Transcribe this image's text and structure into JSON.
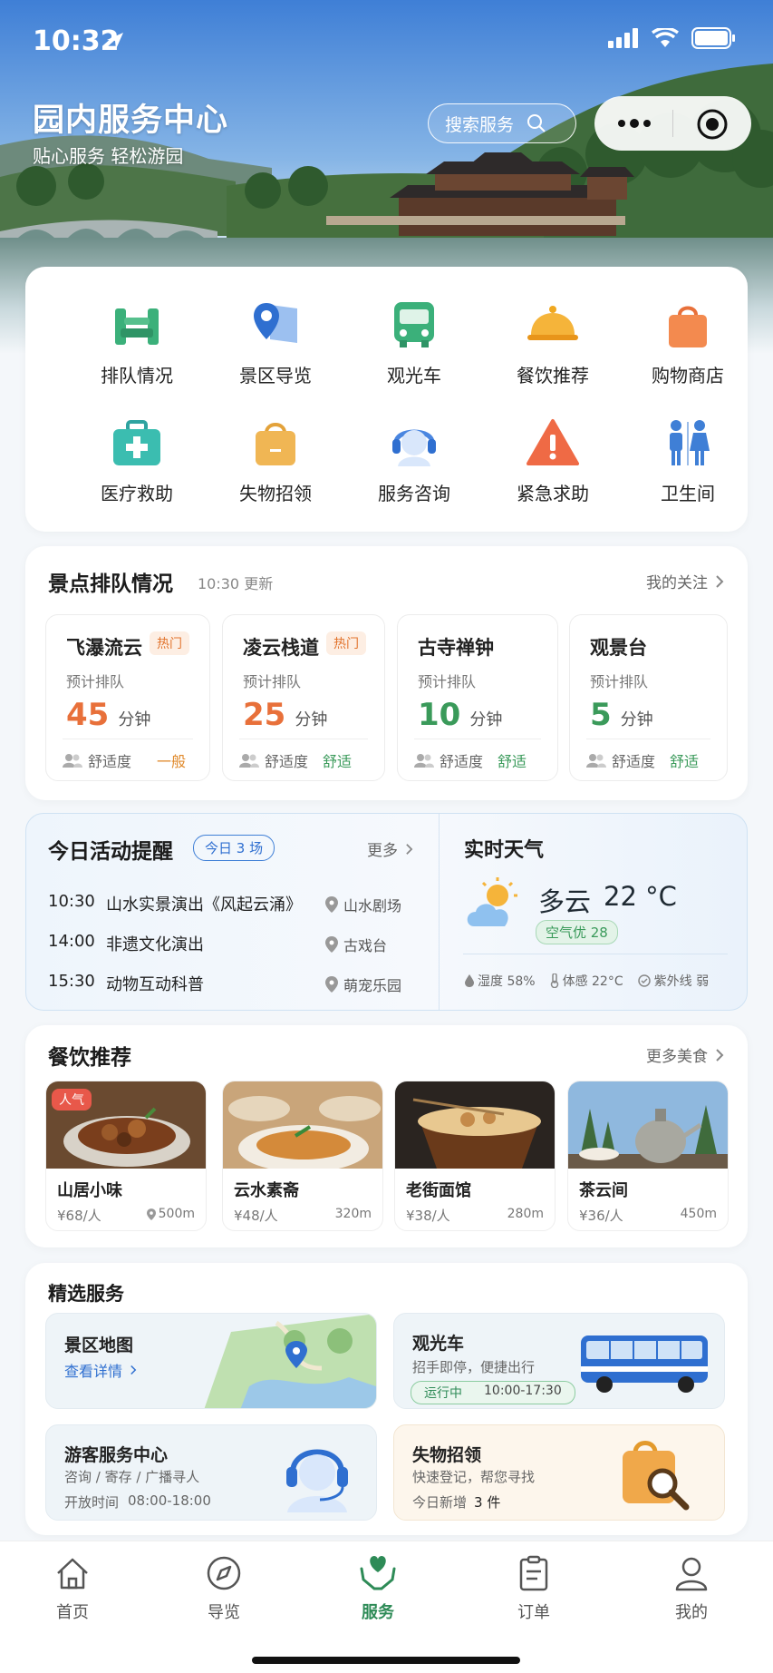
{
  "status_bar": {
    "time": "10:32"
  },
  "hero": {
    "title": "园内服务中心",
    "subtitle": "贴心服务  轻松游园",
    "search_label": "搜索服务"
  },
  "quick_grid": {
    "items": [
      {
        "label": "排队情况",
        "icon": "queue-turnstile-icon"
      },
      {
        "label": "景区导览",
        "icon": "map-pin-icon"
      },
      {
        "label": "观光车",
        "icon": "bus-icon"
      },
      {
        "label": "餐饮推荐",
        "icon": "food-cloche-icon"
      },
      {
        "label": "购物商店",
        "icon": "shopping-bag-icon"
      },
      {
        "label": "医疗救助",
        "icon": "first-aid-kit-icon"
      },
      {
        "label": "失物招领",
        "icon": "lost-bag-icon"
      },
      {
        "label": "服务咨询",
        "icon": "headset-agent-icon"
      },
      {
        "label": "紧急求助",
        "icon": "warning-triangle-icon"
      },
      {
        "label": "卫生间",
        "icon": "restroom-icon"
      }
    ]
  },
  "queue": {
    "title": "景点排队情况",
    "updated": "10:30 更新",
    "more": "我的关注",
    "est_label": "预计排队",
    "unit": "分钟",
    "comfort_label": "舒适度",
    "spots": [
      {
        "name": "飞瀑流云",
        "tag": "热门",
        "wait": "45",
        "comfort": "一般",
        "color": "#e8703a",
        "comfort_color": "#e08a2c"
      },
      {
        "name": "凌云栈道",
        "tag": "热门",
        "wait": "25",
        "comfort": "舒适",
        "color": "#e8703a",
        "comfort_color": "#3a9a5a"
      },
      {
        "name": "古寺禅钟",
        "tag": "",
        "wait": "10",
        "comfort": "舒适",
        "color": "#3a9a5a",
        "comfort_color": "#3a9a5a"
      },
      {
        "name": "观景台",
        "tag": "",
        "wait": "5",
        "comfort": "舒适",
        "color": "#3a9a5a",
        "comfort_color": "#3a9a5a"
      }
    ]
  },
  "activities": {
    "title": "今日活动提醒",
    "badge": "今日 3 场",
    "more": "更多",
    "items": [
      {
        "time": "10:30",
        "name": "山水实景演出《风起云涌》",
        "place": "山水剧场"
      },
      {
        "time": "14:00",
        "name": "非遗文化演出",
        "place": "古戏台"
      },
      {
        "time": "15:30",
        "name": "动物互动科普",
        "place": "萌宠乐园"
      }
    ]
  },
  "weather": {
    "title": "实时天气",
    "condition": "多云",
    "temp": "22 °C",
    "aqi": "空气优 28",
    "humidity": "湿度 58%",
    "feels": "体感 22°C",
    "uv": "紫外线 弱"
  },
  "food": {
    "title": "餐饮推荐",
    "more": "更多美食",
    "items": [
      {
        "name": "山居小味",
        "price": "¥68/人",
        "dist": "500m",
        "badge": "人气"
      },
      {
        "name": "云水素斋",
        "price": "¥48/人",
        "dist": "320m",
        "badge": ""
      },
      {
        "name": "老街面馆",
        "price": "¥38/人",
        "dist": "280m",
        "badge": ""
      },
      {
        "name": "茶云间",
        "price": "¥36/人",
        "dist": "450m",
        "badge": ""
      }
    ]
  },
  "services": {
    "title": "精选服务",
    "map": {
      "title": "景区地图",
      "link": "查看详情"
    },
    "bus": {
      "title": "观光车",
      "desc": "招手即停，便捷出行",
      "status": "运行中",
      "hours": "10:00-17:30"
    },
    "center": {
      "title": "游客服务中心",
      "desc": "咨询 / 寄存 / 广播寻人",
      "hours_label": "开放时间",
      "hours": "08:00-18:00"
    },
    "lost": {
      "title": "失物招领",
      "desc": "快速登记，帮您寻找",
      "today_label": "今日新增",
      "today_count": "3 件"
    }
  },
  "tabbar": {
    "tabs": [
      {
        "label": "首页",
        "icon": "home-icon"
      },
      {
        "label": "导览",
        "icon": "compass-icon"
      },
      {
        "label": "服务",
        "icon": "heart-hands-icon",
        "active": true
      },
      {
        "label": "订单",
        "icon": "clipboard-icon"
      },
      {
        "label": "我的",
        "icon": "user-icon"
      }
    ]
  },
  "colors": {
    "accent": "#2e8b57",
    "orange": "#e8703a",
    "blue": "#2f6fd0"
  }
}
